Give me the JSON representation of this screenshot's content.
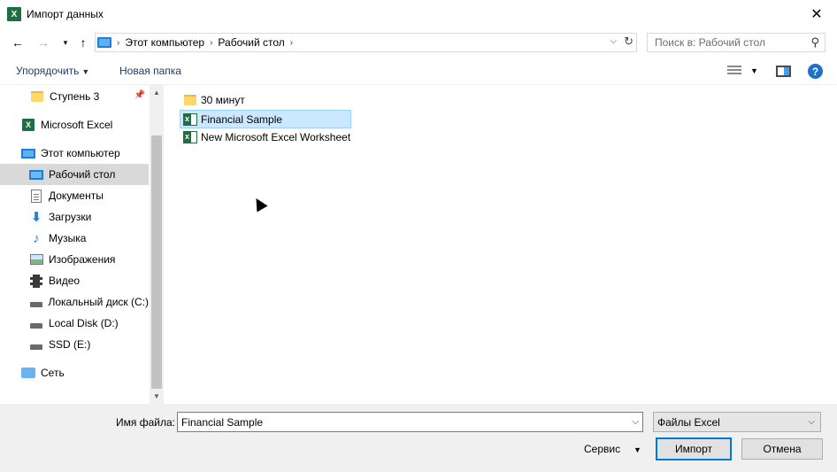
{
  "window": {
    "title": "Импорт данных",
    "app_icon_letter": "X",
    "close_glyph": "✕"
  },
  "address": {
    "crumbs": [
      "Этот компьютер",
      "Рабочий стол"
    ],
    "search_placeholder": "Поиск в: Рабочий стол"
  },
  "toolbar": {
    "organize_label": "Упорядочить",
    "new_folder_label": "Новая папка",
    "help_glyph": "?"
  },
  "nav": {
    "items": [
      {
        "label": "Ступень 3",
        "icon": "folder-icon",
        "pinned": true
      },
      {
        "label": "Microsoft Excel",
        "icon": "excel-icon"
      },
      {
        "label": "Этот компьютер",
        "icon": "computer-icon"
      },
      {
        "label": "Рабочий стол",
        "icon": "desktop-icon",
        "selected": true
      },
      {
        "label": "Документы",
        "icon": "documents-icon"
      },
      {
        "label": "Загрузки",
        "icon": "downloads-icon"
      },
      {
        "label": "Музыка",
        "icon": "music-icon"
      },
      {
        "label": "Изображения",
        "icon": "pictures-icon"
      },
      {
        "label": "Видео",
        "icon": "video-icon"
      },
      {
        "label": "Локальный диск (C:)",
        "icon": "drive-icon"
      },
      {
        "label": "Local Disk (D:)",
        "icon": "drive-icon"
      },
      {
        "label": "SSD (E:)",
        "icon": "drive-icon"
      },
      {
        "label": "Сеть",
        "icon": "network-icon"
      }
    ]
  },
  "files": [
    {
      "name": "30 минут",
      "type": "folder"
    },
    {
      "name": "Financial Sample",
      "type": "excel",
      "selected": true
    },
    {
      "name": "New Microsoft Excel Worksheet",
      "type": "excel"
    }
  ],
  "bottom": {
    "filename_label": "Имя файла:",
    "filename_value": "Financial Sample",
    "filetype_value": "Файлы Excel",
    "service_label": "Сервис",
    "import_label": "Импорт",
    "cancel_label": "Отмена"
  }
}
